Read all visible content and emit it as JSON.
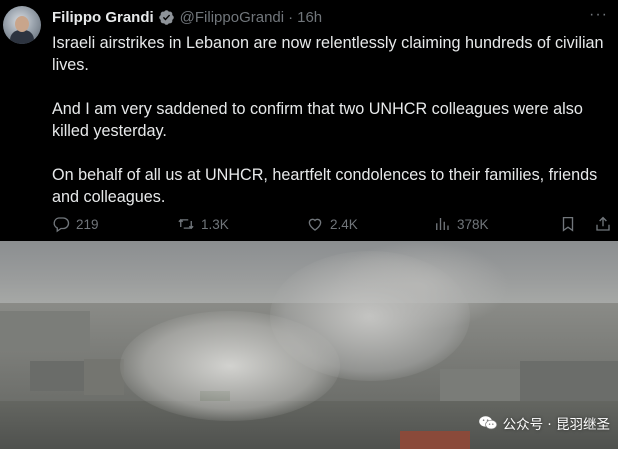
{
  "tweet": {
    "author_name": "Filippo Grandi",
    "handle": "@FilippoGrandi",
    "separator": "·",
    "time": "16h",
    "more_label": "···",
    "paragraphs": [
      "Israeli airstrikes in Lebanon are now relentlessly claiming hundreds of civilian lives.",
      "And I am very saddened to confirm that two UNHCR colleagues were also killed yesterday.",
      "On behalf of all us at UNHCR, heartfelt condolences to their families, friends and colleagues."
    ],
    "actions": {
      "replies": "219",
      "retweets": "1.3K",
      "likes": "2.4K",
      "views": "378K"
    },
    "icons": {
      "verified": "verified-badge-icon",
      "reply": "reply-icon",
      "retweet": "retweet-icon",
      "like": "heart-icon",
      "views": "views-bar-chart-icon",
      "bookmark": "bookmark-icon",
      "share": "share-icon"
    }
  },
  "photo": {
    "watermark": "公众号 · 昆羽继圣",
    "watermark_icon": "wechat-icon"
  },
  "colors": {
    "background": "#000000",
    "text": "#e7e9ea",
    "muted": "#71767b",
    "verified_badge": "#8e9399"
  }
}
